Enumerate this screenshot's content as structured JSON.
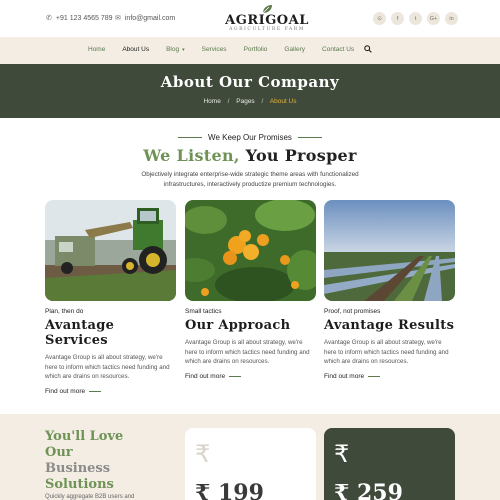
{
  "topbar": {
    "phone": "+91 123 4565 789",
    "email": "info@gmail.com",
    "logo_text": "AGRIGOAL",
    "logo_sub": "AGRICULTURE FARM",
    "socials": [
      {
        "icon": "rss-icon",
        "glyph": "⊙"
      },
      {
        "icon": "facebook-icon",
        "glyph": "f"
      },
      {
        "icon": "twitter-icon",
        "glyph": "t"
      },
      {
        "icon": "google-plus-icon",
        "glyph": "G+"
      },
      {
        "icon": "linkedin-icon",
        "glyph": "in"
      }
    ]
  },
  "nav": {
    "items": [
      {
        "label": "Home"
      },
      {
        "label": "About Us"
      },
      {
        "label": "Blog"
      },
      {
        "label": "Services"
      },
      {
        "label": "Portfolio"
      },
      {
        "label": "Gallery"
      },
      {
        "label": "Contact Us"
      }
    ]
  },
  "banner": {
    "title": "About Our Company",
    "crumbs": [
      "Home",
      "Pages",
      "About Us"
    ]
  },
  "intro": {
    "eyebrow": "We Keep Our Promises",
    "headline_a": "We Listen,",
    "headline_b": "You Prosper",
    "text": "Objectively integrate enterprise-wide strategic theme areas with functionalized infrastructures, interactively productize premium technologies."
  },
  "cards": [
    {
      "kicker": "Plan, then do",
      "title": "Avantage Services",
      "desc": "Avantage Group is all about strategy, we're here to inform which tactics need funding and which are drains on resources.",
      "more": "Find out more"
    },
    {
      "kicker": "Small tactics",
      "title": "Our Approach",
      "desc": "Avantage Group is all about strategy, we're here to inform which tactics need funding and which are drains on resources.",
      "more": "Find out more"
    },
    {
      "kicker": "Proof, not promises",
      "title": "Avantage Results",
      "desc": "Avantage Group is all about strategy, we're here to inform which tactics need funding and which are drains on resources.",
      "more": "Find out more"
    }
  ],
  "pricing": {
    "title_1": "You'll Love",
    "title_2": "Our",
    "title_3": "Business",
    "title_4": "Solutions",
    "desc": "Quickly aggregate B2B users and",
    "plans": [
      {
        "currency": "₹",
        "amount": "₹ 199"
      },
      {
        "currency": "₹",
        "amount": "₹ 259"
      }
    ]
  },
  "colors": {
    "accent_green": "#6f9256",
    "banner_dark": "#3f4a3a",
    "nav_bg": "#f3ede4",
    "breadcrumb_active": "#e3b23c"
  }
}
